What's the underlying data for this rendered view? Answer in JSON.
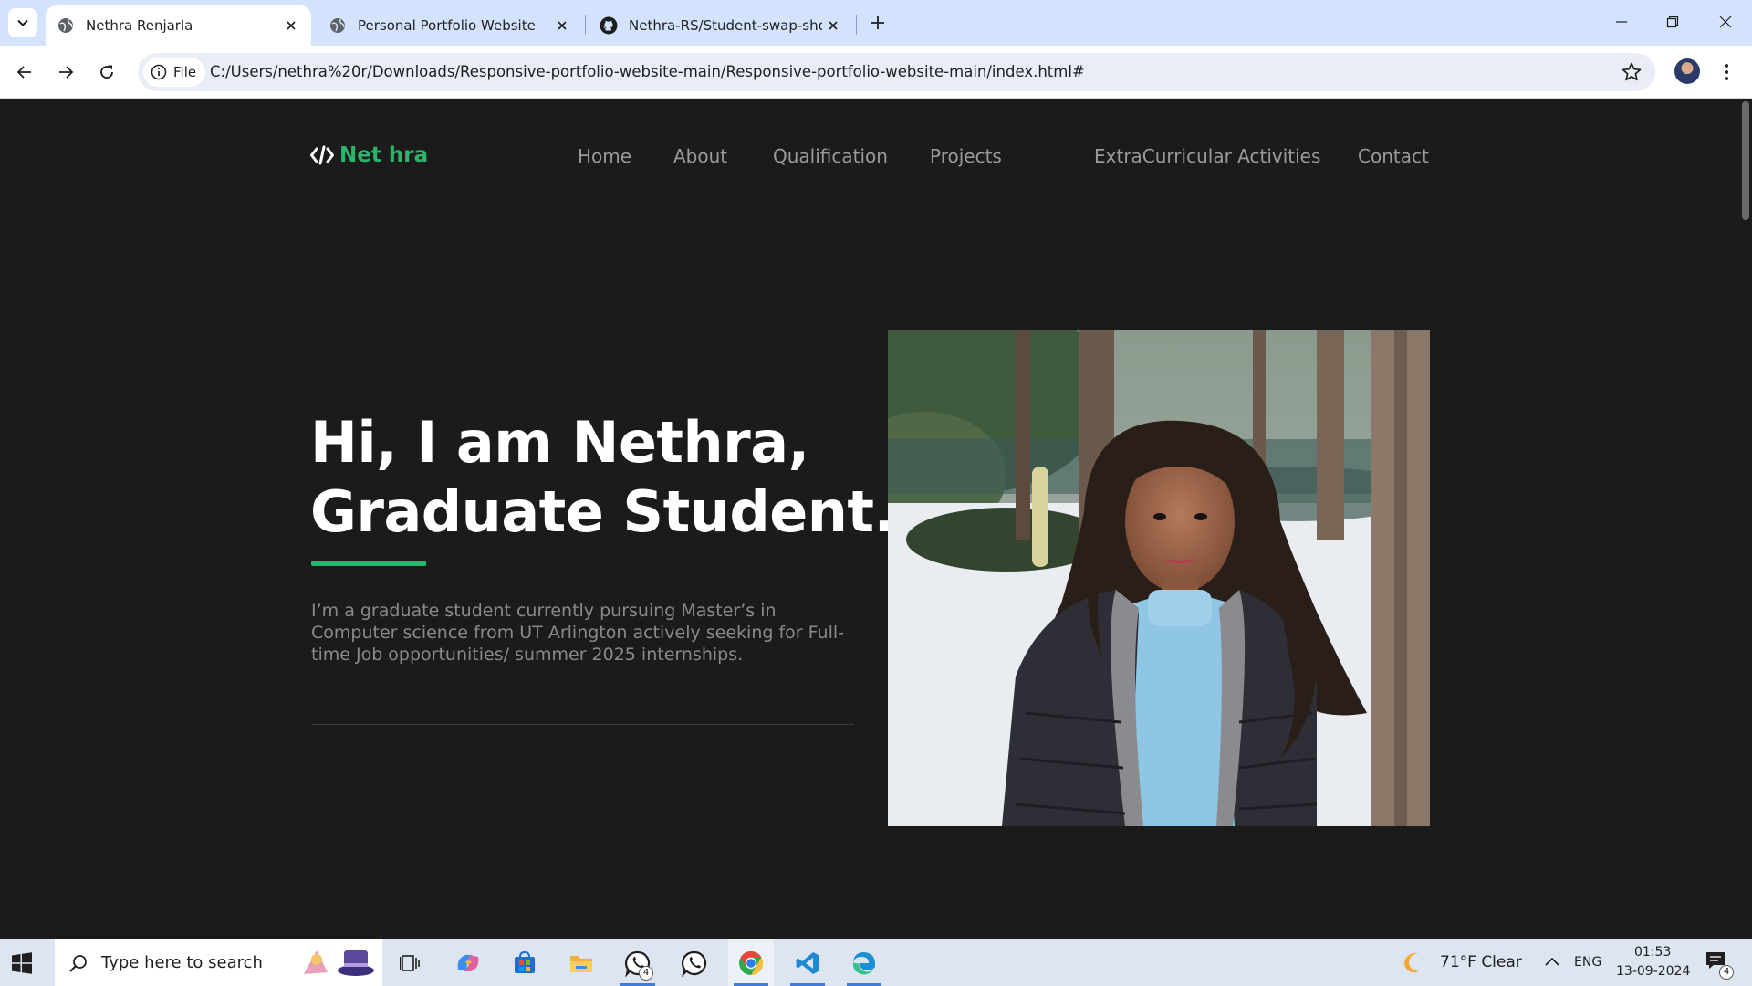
{
  "browser": {
    "tabs": [
      {
        "title": "Nethra Renjarla",
        "active": true
      },
      {
        "title": "Personal Portfolio Website",
        "active": false
      },
      {
        "title": "Nethra-RS/Student-swap-shop",
        "active": false
      }
    ],
    "chip_label": "File",
    "url": "C:/Users/nethra%20r/Downloads/Responsive-portfolio-website-main/Responsive-portfolio-website-main/index.html#"
  },
  "site": {
    "logo": "Net hra",
    "nav": [
      "Home",
      "About",
      "Qualification",
      "Projects",
      "ExtraCurricular Activities",
      "Contact"
    ],
    "hero_line1": "Hi, I am Nethra,",
    "hero_line2": "Graduate Student.",
    "hero_text": "I’m a graduate student currently pursuing Master’s in Computer science from UT Arlington actively seeking for Full-time Job opportunities/ summer 2025 internships.",
    "accent_color": "#2ab56c",
    "background_color": "#1b1b1b"
  },
  "taskbar": {
    "search_placeholder": "Type here to search",
    "whatsapp_badge": "4",
    "weather": "71°F  Clear",
    "language": "ENG",
    "time": "01:53",
    "date": "13-09-2024",
    "notification_count": "4"
  },
  "icons": [
    "tab-search-icon",
    "globe-icon",
    "github-icon",
    "close-icon",
    "plus-icon",
    "minimize-icon",
    "restore-icon",
    "back-icon",
    "forward-icon",
    "reload-icon",
    "info-icon",
    "star-icon",
    "profile-avatar",
    "kebab-icon",
    "code-icon",
    "windows-icon",
    "search-icon",
    "task-view-icon",
    "copilot-icon",
    "store-icon",
    "file-explorer-icon",
    "whatsapp-icon",
    "chrome-icon",
    "vscode-icon",
    "edge-icon",
    "moon-icon",
    "chevron-up-icon",
    "notification-icon"
  ]
}
